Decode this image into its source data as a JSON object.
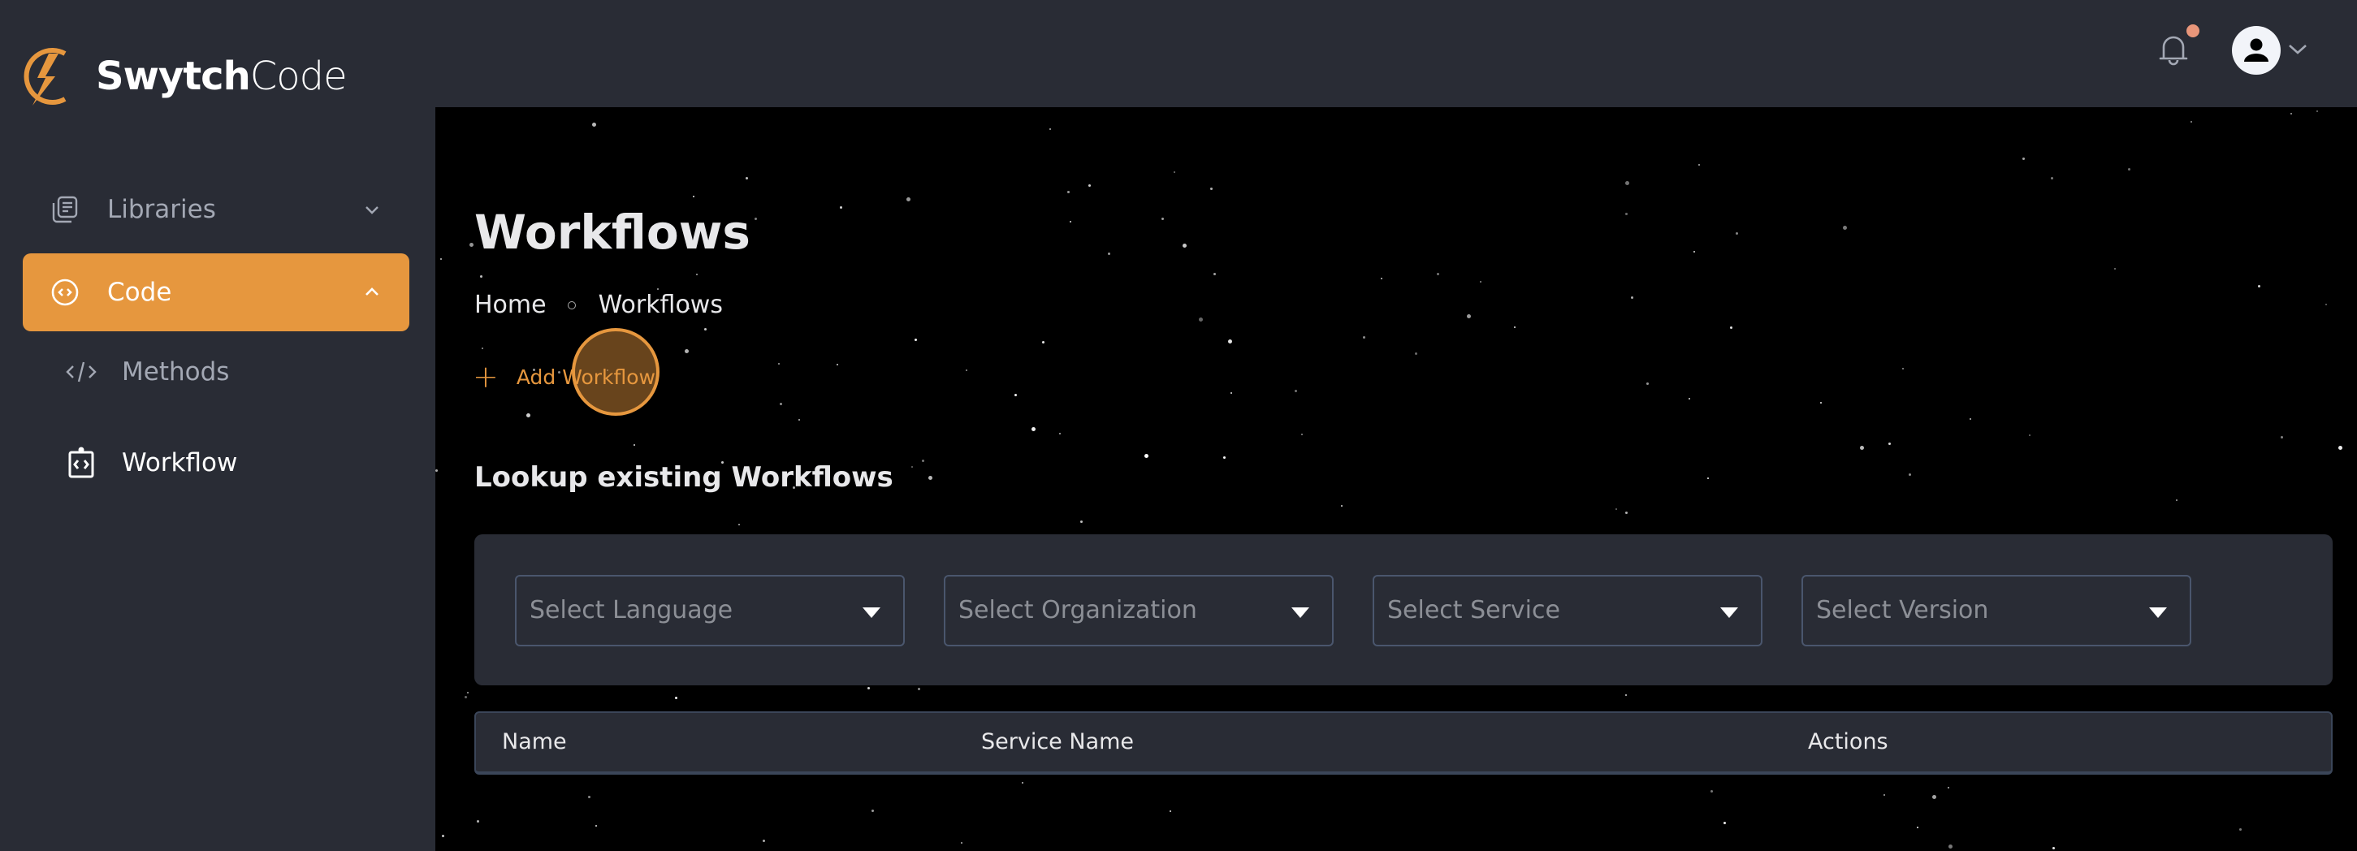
{
  "brand": {
    "name_bold": "Swytch",
    "name_light": "Code",
    "accent_color": "#e6973e"
  },
  "sidebar": {
    "items": [
      {
        "label": "Libraries",
        "icon": "library-icon",
        "expanded": false
      },
      {
        "label": "Code",
        "icon": "code-circle-icon",
        "expanded": true,
        "active": true
      }
    ],
    "sub_items": [
      {
        "label": "Methods",
        "icon": "code-tag-icon"
      },
      {
        "label": "Workflow",
        "icon": "clipboard-code-icon",
        "active": true
      }
    ]
  },
  "header": {
    "notifications": {
      "icon": "bell-icon",
      "has_unread": true
    },
    "user_menu": {
      "icon": "user-avatar-icon"
    }
  },
  "page": {
    "title": "Workflows",
    "breadcrumb": [
      "Home",
      "Workflows"
    ],
    "add_button": "Add Workflow",
    "section_title": "Lookup existing Workflows"
  },
  "filters": [
    {
      "placeholder": "Select Language",
      "value": ""
    },
    {
      "placeholder": "Select Organization",
      "value": ""
    },
    {
      "placeholder": "Select Service",
      "value": ""
    },
    {
      "placeholder": "Select Version",
      "value": ""
    }
  ],
  "table": {
    "columns": [
      "Name",
      "Service Name",
      "Actions"
    ],
    "rows": []
  }
}
